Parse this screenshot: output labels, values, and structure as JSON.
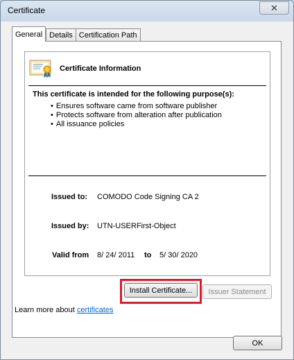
{
  "window": {
    "title": "Certificate",
    "close_glyph": "✕"
  },
  "tabs": [
    {
      "label": "General",
      "active": true
    },
    {
      "label": "Details",
      "active": false
    },
    {
      "label": "Certification Path",
      "active": false
    }
  ],
  "cert": {
    "icon": "certificate-icon",
    "info_title": "Certificate Information",
    "purpose_heading": "This certificate is intended for the following purpose(s):",
    "purposes": [
      "Ensures software came from software publisher",
      "Protects software from alteration after publication",
      "All issuance policies"
    ],
    "issued_to_label": "Issued to:",
    "issued_to": "COMODO Code Signing CA 2",
    "issued_by_label": "Issued by:",
    "issued_by": "UTN-USERFirst-Object",
    "valid_from_label": "Valid from",
    "valid_from": "8/ 24/ 2011",
    "to_label": "to",
    "valid_to": "5/ 30/ 2020"
  },
  "buttons": {
    "install": "Install Certificate...",
    "issuer_statement": "Issuer Statement",
    "ok": "OK"
  },
  "learn": {
    "prefix": "Learn more about",
    "link": "certificates"
  },
  "colors": {
    "highlight": "#e0182b",
    "link": "#0066cc"
  }
}
